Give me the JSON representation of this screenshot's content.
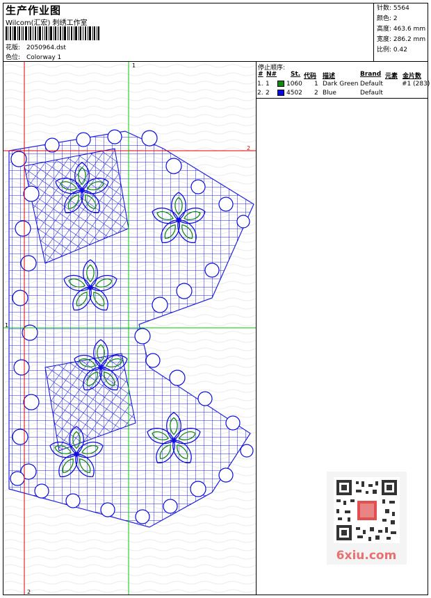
{
  "header": {
    "title": "生产作业图",
    "company": "Wilcom(汇宏)  刺绣工作室",
    "design_label": "花版:",
    "design_value": "2050964.dst",
    "colorway_label": "色位:",
    "colorway_value": "Colorway 1"
  },
  "stats": [
    {
      "label": "针数:",
      "value": "5564"
    },
    {
      "label": "颜色:",
      "value": "2"
    },
    {
      "label": "高度:",
      "value": "463.6 mm"
    },
    {
      "label": "宽度:",
      "value": "286.2 mm"
    },
    {
      "label": "比例:",
      "value": "0.42"
    }
  ],
  "stops": {
    "title": "停止顺序:",
    "columns": [
      "#",
      "N#",
      "St.",
      "代码",
      "描述",
      "Brand",
      "元素",
      "金片数"
    ],
    "rows": [
      {
        "num": "1.",
        "n": "1",
        "color": "#0e8a0e",
        "st": "1060",
        "code": "1",
        "desc": "Dark Green",
        "brand": "Default",
        "elem": "",
        "sequin": "#1 (283)"
      },
      {
        "num": "2.",
        "n": "2",
        "color": "#0a0ae0",
        "st": "4502",
        "code": "2",
        "desc": "Blue",
        "brand": "Default",
        "elem": "",
        "sequin": ""
      }
    ]
  },
  "guides": {
    "v1_top": "1",
    "v2_bottom": "2",
    "h1_left": "1",
    "h2_right": "2"
  },
  "watermark": {
    "text": "6xiu.com"
  },
  "colors": {
    "thread_blue": "#0a0ae0",
    "thread_green": "#0e8a0e",
    "guide_red": "#e00000",
    "guide_green": "#00c800"
  }
}
